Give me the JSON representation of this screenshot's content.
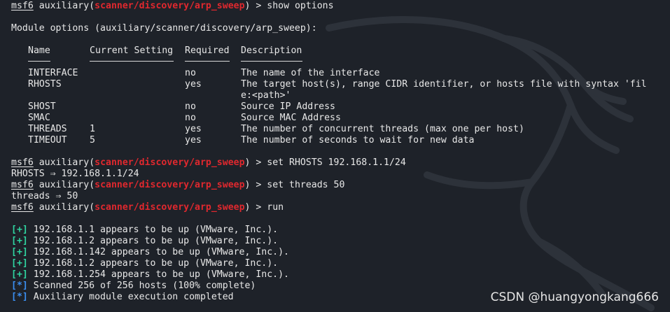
{
  "terminal": {
    "background": "#1e2229",
    "prompt": {
      "msf": "msf6",
      "word": "auxiliary",
      "module": "scanner/discovery/arp_sweep",
      "suffix": ") > ",
      "module_color": "#e0282e"
    },
    "commands": {
      "show": "show options",
      "set_rhosts": "set RHOSTS 192.168.1.1/24",
      "set_threads": "set threads 50",
      "run": "run"
    },
    "module_options_title": "Module options (auxiliary/scanner/discovery/arp_sweep):",
    "table": {
      "headers": [
        "Name",
        "Current Setting",
        "Required",
        "Description"
      ],
      "rows": [
        {
          "name": "INTERFACE",
          "setting": "",
          "required": "no",
          "desc": "The name of the interface"
        },
        {
          "name": "RHOSTS",
          "setting": "",
          "required": "yes",
          "desc": "The target host(s), range CIDR identifier, or hosts file with syntax 'fil",
          "desc2": "e:<path>'"
        },
        {
          "name": "SHOST",
          "setting": "",
          "required": "no",
          "desc": "Source IP Address"
        },
        {
          "name": "SMAC",
          "setting": "",
          "required": "no",
          "desc": "Source MAC Address"
        },
        {
          "name": "THREADS",
          "setting": "1",
          "required": "yes",
          "desc": "The number of concurrent threads (max one per host)"
        },
        {
          "name": "TIMEOUT",
          "setting": "5",
          "required": "yes",
          "desc": "The number of seconds to wait for new data"
        }
      ]
    },
    "echo_rhosts": "RHOSTS ⇒ 192.168.1.1/24",
    "echo_threads": "threads ⇒ 50",
    "results": [
      {
        "tag": "[+]",
        "text": " 192.168.1.1 appears to be up (VMware, Inc.)."
      },
      {
        "tag": "[+]",
        "text": " 192.168.1.2 appears to be up (VMware, Inc.)."
      },
      {
        "tag": "[+]",
        "text": " 192.168.1.142 appears to be up (VMware, Inc.)."
      },
      {
        "tag": "[+]",
        "text": " 192.168.1.2 appears to be up (VMware, Inc.)."
      },
      {
        "tag": "[+]",
        "text": " 192.168.1.254 appears to be up (VMware, Inc.)."
      },
      {
        "tag": "[*]",
        "text": " Scanned 256 of 256 hosts (100% complete)"
      },
      {
        "tag": "[*]",
        "text": " Auxiliary module execution completed"
      }
    ],
    "tag_colors": {
      "plus": "#2fd4a0",
      "star": "#3b8ef0"
    },
    "watermark": "CSDN @huangyongkang666"
  }
}
